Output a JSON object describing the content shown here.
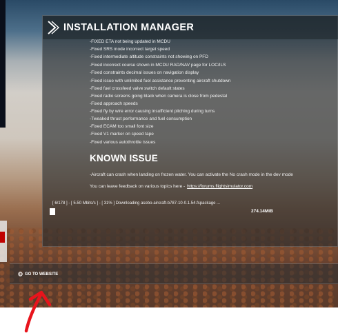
{
  "window": {
    "title": "INSTALLATION MANAGER",
    "logo_icon": "chevron-logo-icon"
  },
  "release_notes": {
    "lines": [
      "-FIXED ETA not being updated in MCDU",
      "-Fixed SRS mode incorrect target speed",
      "-Fixed intermediate altitude constraints not showing on PFD",
      "-Fixed incorrect course shown in MCDU RAD/NAV page for LOC/ILS",
      "-Fixed constraints decimal issues on navigation display",
      "-Fixed issue with unlimited fuel assistance preventing aircraft shutdown",
      "-Fixed fuel crossfeed valve switch default states",
      "-Fixed radio screens going black when camera is close from pedestal",
      "-Fixed approach speeds",
      "-Fixed fly by wire error causing insufficient pitching during turns",
      "-Tweaked thrust performance and fuel consumption",
      "-Fixed ECAM too small font size",
      "-Fixed V1 marker on speed tape",
      "-Fixed various autothrottle issues"
    ],
    "known_issue_heading": "KNOWN ISSUE",
    "known_issue_text": "-Aircraft can crash when landing on frozen water. You can activate the No crash mode in the dev mode",
    "feedback_text": "You can leave feedback on various topics here -",
    "feedback_link": "https://forums.flightsimulator.com"
  },
  "download": {
    "status_text": "[ 6/178 ] - [ 5.50 Mbits/s ] - [ 31% ] Downloading asobo-aircraft-b787-10-0.1.54.fspackage ...",
    "progress": 0.02,
    "size_text": "274.14MiB"
  },
  "footer": {
    "website_label": "GO TO WEBSITE",
    "website_icon": "globe-icon"
  },
  "annotation": {
    "arrow_color": "#e8141c"
  }
}
